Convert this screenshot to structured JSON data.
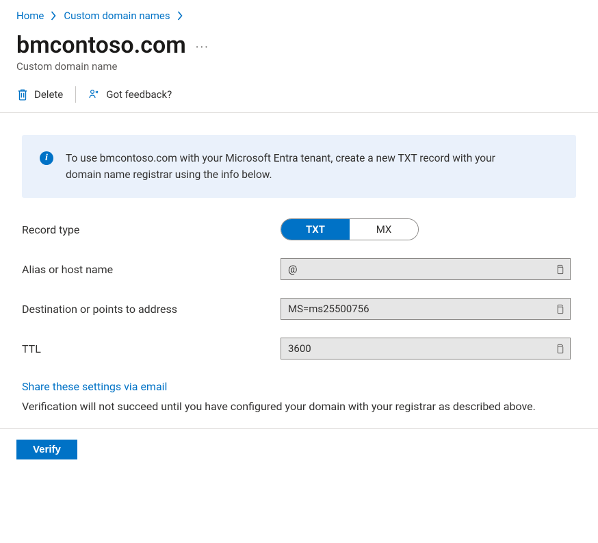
{
  "breadcrumb": {
    "home": "Home",
    "custom_domains": "Custom domain names"
  },
  "title": "bmcontoso.com",
  "subtitle": "Custom domain name",
  "toolbar": {
    "delete": "Delete",
    "feedback": "Got feedback?"
  },
  "infobox": {
    "text": "To use bmcontoso.com with your Microsoft Entra tenant, create a new TXT record with your domain name registrar using the info below."
  },
  "form": {
    "record_type_label": "Record type",
    "record_type_options": {
      "txt": "TXT",
      "mx": "MX"
    },
    "alias_label": "Alias or host name",
    "alias_value": "@",
    "destination_label": "Destination or points to address",
    "destination_value": "MS=ms25500756",
    "ttl_label": "TTL",
    "ttl_value": "3600"
  },
  "share_link": "Share these settings via email",
  "verification_note": "Verification will not succeed until you have configured your domain with your registrar as described above.",
  "verify_button": "Verify"
}
